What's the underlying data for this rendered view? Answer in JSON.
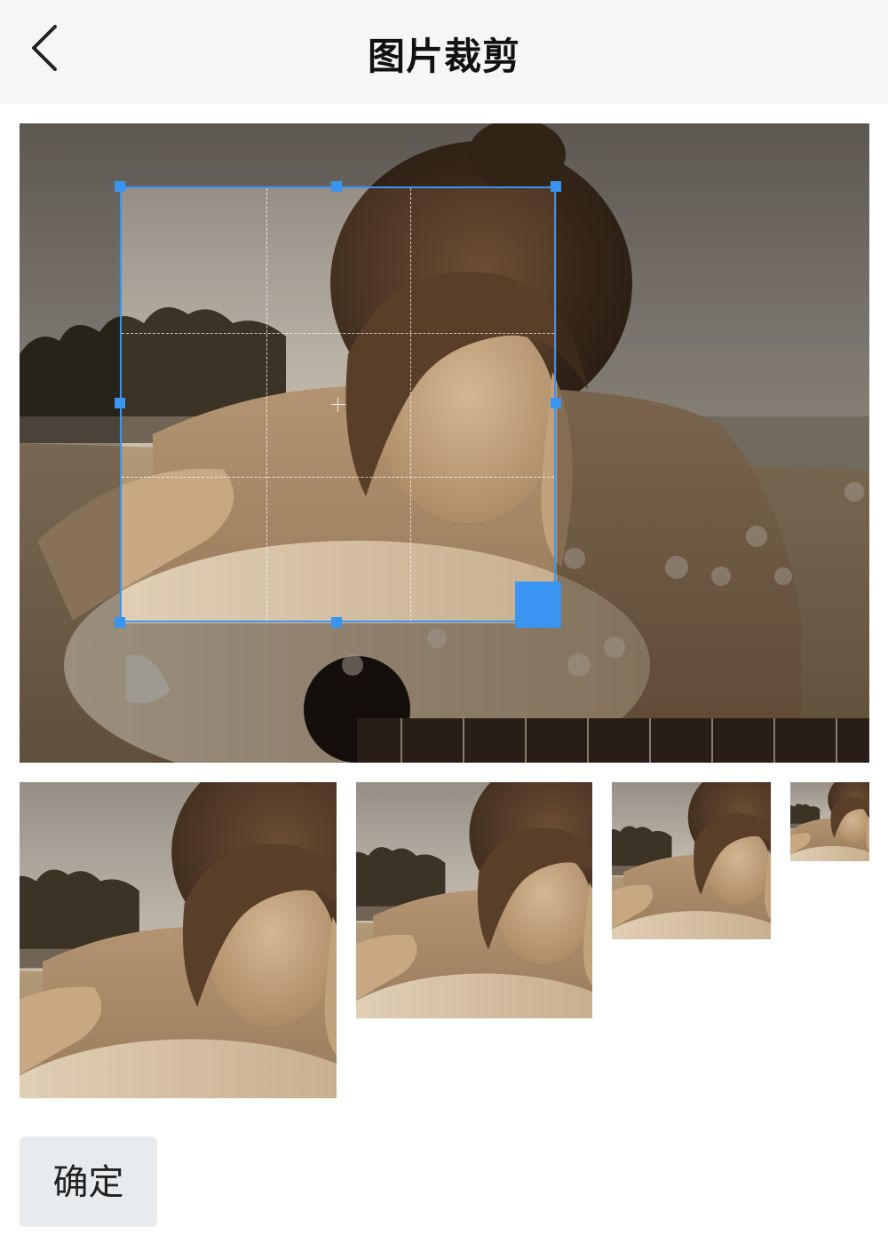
{
  "header": {
    "title": "图片裁剪",
    "back_icon": "chevron-left-icon"
  },
  "crop": {
    "grid": "3x3",
    "accent": "#3994f2"
  },
  "previews": {
    "count": 4
  },
  "actions": {
    "confirm_label": "确定"
  }
}
